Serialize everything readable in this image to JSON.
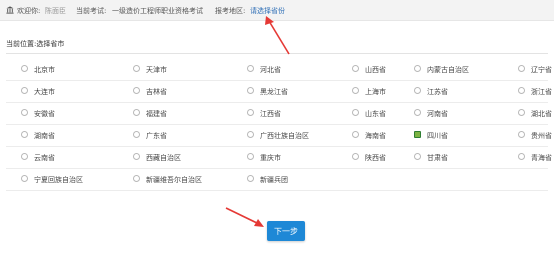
{
  "header": {
    "welcome_label": "欢迎你:",
    "username": "陈面臣",
    "exam_label": "当前考试:",
    "exam_name": "一级造价工程师职业资格考试",
    "region_label": "报考地区:",
    "region_value": "请选择省份"
  },
  "breadcrumb": {
    "label": "当前位置:",
    "value": "选择省市"
  },
  "provinces": [
    [
      "北京市",
      "天津市",
      "河北省",
      "山西省",
      "内蒙古自治区",
      "辽宁省"
    ],
    [
      "大连市",
      "吉林省",
      "黑龙江省",
      "上海市",
      "江苏省",
      "浙江省"
    ],
    [
      "安徽省",
      "福建省",
      "江西省",
      "山东省",
      "河南省",
      "湖北省"
    ],
    [
      "湖南省",
      "广东省",
      "广西壮族自治区",
      "海南省",
      "四川省",
      "贵州省"
    ],
    [
      "云南省",
      "西藏自治区",
      "重庆市",
      "陕西省",
      "甘肃省",
      "青海省"
    ],
    [
      "宁夏回族自治区",
      "新疆维吾尔自治区",
      "新疆兵团"
    ]
  ],
  "selected_province": "四川省",
  "next_button": "下一步",
  "colors": {
    "accent": "#1e88d6",
    "annotation": "#e53935",
    "selected": "#7cb342"
  }
}
